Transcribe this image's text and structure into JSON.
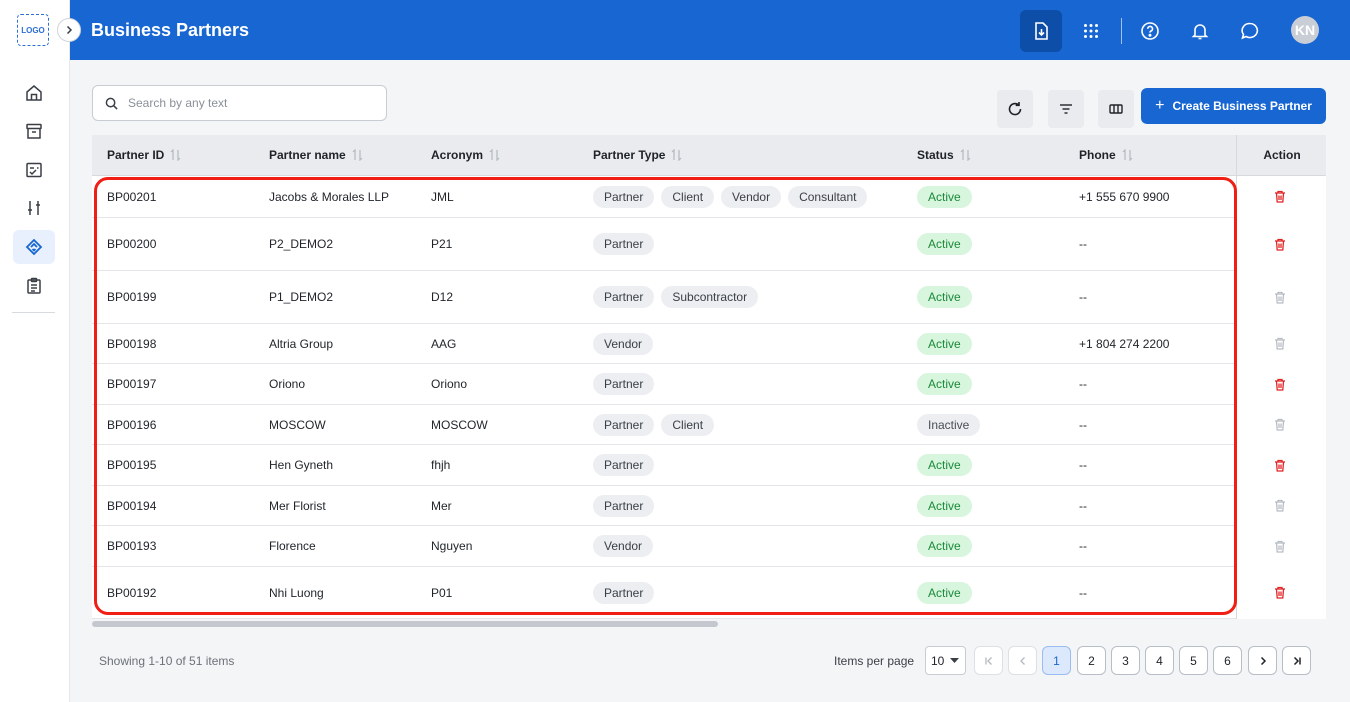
{
  "sidebar": {
    "logo_text": "LOGO",
    "items": [
      {
        "name": "home",
        "icon": "home-icon"
      },
      {
        "name": "archive",
        "icon": "archive-icon"
      },
      {
        "name": "tasks",
        "icon": "checklist-icon"
      },
      {
        "name": "adjustments",
        "icon": "sliders-icon"
      },
      {
        "name": "business-partners",
        "icon": "handshake-icon",
        "active": true
      },
      {
        "name": "reports",
        "icon": "clipboard-icon"
      }
    ]
  },
  "header": {
    "title": "Business Partners",
    "avatar_initials": "KN",
    "brand_color": "#1766d2"
  },
  "toolbar": {
    "search_placeholder": "Search by any text",
    "create_label": "Create Business Partner"
  },
  "table": {
    "columns": [
      "Partner ID",
      "Partner name",
      "Acronym",
      "Partner Type",
      "Status",
      "Phone",
      "Action"
    ],
    "rows": [
      {
        "id": "BP00201",
        "name": "Jacobs & Morales LLP",
        "acronym": "JML",
        "types": [
          "Partner",
          "Client",
          "Vendor",
          "Consultant"
        ],
        "status": "Active",
        "phone": "+1 555 670 9900",
        "delete_enabled": true
      },
      {
        "id": "BP00200",
        "name": "P2_DEMO2",
        "acronym": "P21",
        "types": [
          "Partner"
        ],
        "status": "Active",
        "phone": "--",
        "delete_enabled": true
      },
      {
        "id": "BP00199",
        "name": "P1_DEMO2",
        "acronym": "D12",
        "types": [
          "Partner",
          "Subcontractor"
        ],
        "status": "Active",
        "phone": "--",
        "delete_enabled": false
      },
      {
        "id": "BP00198",
        "name": "Altria Group",
        "acronym": "AAG",
        "types": [
          "Vendor"
        ],
        "status": "Active",
        "phone": "+1 804 274 2200",
        "delete_enabled": false
      },
      {
        "id": "BP00197",
        "name": "Oriono",
        "acronym": "Oriono",
        "types": [
          "Partner"
        ],
        "status": "Active",
        "phone": "--",
        "delete_enabled": true
      },
      {
        "id": "BP00196",
        "name": "MOSCOW",
        "acronym": "MOSCOW",
        "types": [
          "Partner",
          "Client"
        ],
        "status": "Inactive",
        "phone": "--",
        "delete_enabled": false
      },
      {
        "id": "BP00195",
        "name": "Hen Gyneth",
        "acronym": "fhjh",
        "types": [
          "Partner"
        ],
        "status": "Active",
        "phone": "--",
        "delete_enabled": true
      },
      {
        "id": "BP00194",
        "name": "Mer Florist",
        "acronym": "Mer",
        "types": [
          "Partner"
        ],
        "status": "Active",
        "phone": "--",
        "delete_enabled": false
      },
      {
        "id": "BP00193",
        "name": "Florence",
        "acronym": "Nguyen",
        "types": [
          "Vendor"
        ],
        "status": "Active",
        "phone": "--",
        "delete_enabled": false
      },
      {
        "id": "BP00192",
        "name": "Nhi Luong",
        "acronym": "P01",
        "types": [
          "Partner"
        ],
        "status": "Active",
        "phone": "--",
        "delete_enabled": true
      }
    ]
  },
  "pagination": {
    "showing_text": "Showing 1-10 of 51 items",
    "items_per_page_label": "Items per page",
    "items_per_page_value": "10",
    "pages": [
      "1",
      "2",
      "3",
      "4",
      "5",
      "6"
    ],
    "current_page": "1"
  },
  "colors": {
    "active_bg": "#d8f5dd",
    "active_text": "#1b8a3a",
    "delete_red": "#e02424",
    "highlight_red": "#f01e14"
  }
}
